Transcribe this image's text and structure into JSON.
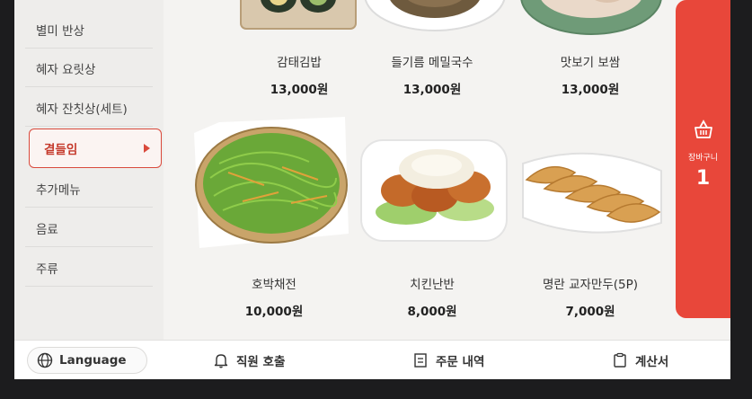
{
  "sidebar": {
    "categories": [
      {
        "label": "별미 반상"
      },
      {
        "label": "혜자 요릿상"
      },
      {
        "label": "혜자 잔칫상(세트)"
      },
      {
        "label": "곁들임"
      },
      {
        "label": "추가메뉴"
      },
      {
        "label": "음료"
      },
      {
        "label": "주류"
      }
    ],
    "active_index": 3
  },
  "menu": {
    "items": [
      {
        "name": "감태김밥",
        "price": "13,000원"
      },
      {
        "name": "들기름 메밀국수",
        "price": "13,000원"
      },
      {
        "name": "맛보기 보쌈",
        "price": "13,000원"
      },
      {
        "name": "호박채전",
        "price": "10,000원"
      },
      {
        "name": "치킨난반",
        "price": "8,000원"
      },
      {
        "name": "명란 교자만두(5P)",
        "price": "7,000원"
      }
    ]
  },
  "cart": {
    "label": "장바구니",
    "count": "1"
  },
  "bottom_bar": {
    "language_label": "Language",
    "call_staff_label": "직원 호출",
    "order_history_label": "주문 내역",
    "bill_label": "계산서"
  },
  "colors": {
    "accent": "#e8473a",
    "active_border": "#d94a3c"
  },
  "icons": [
    "basket-icon",
    "globe-icon",
    "bell-icon",
    "receipt-list-icon",
    "clipboard-icon",
    "chevron-right-icon"
  ]
}
